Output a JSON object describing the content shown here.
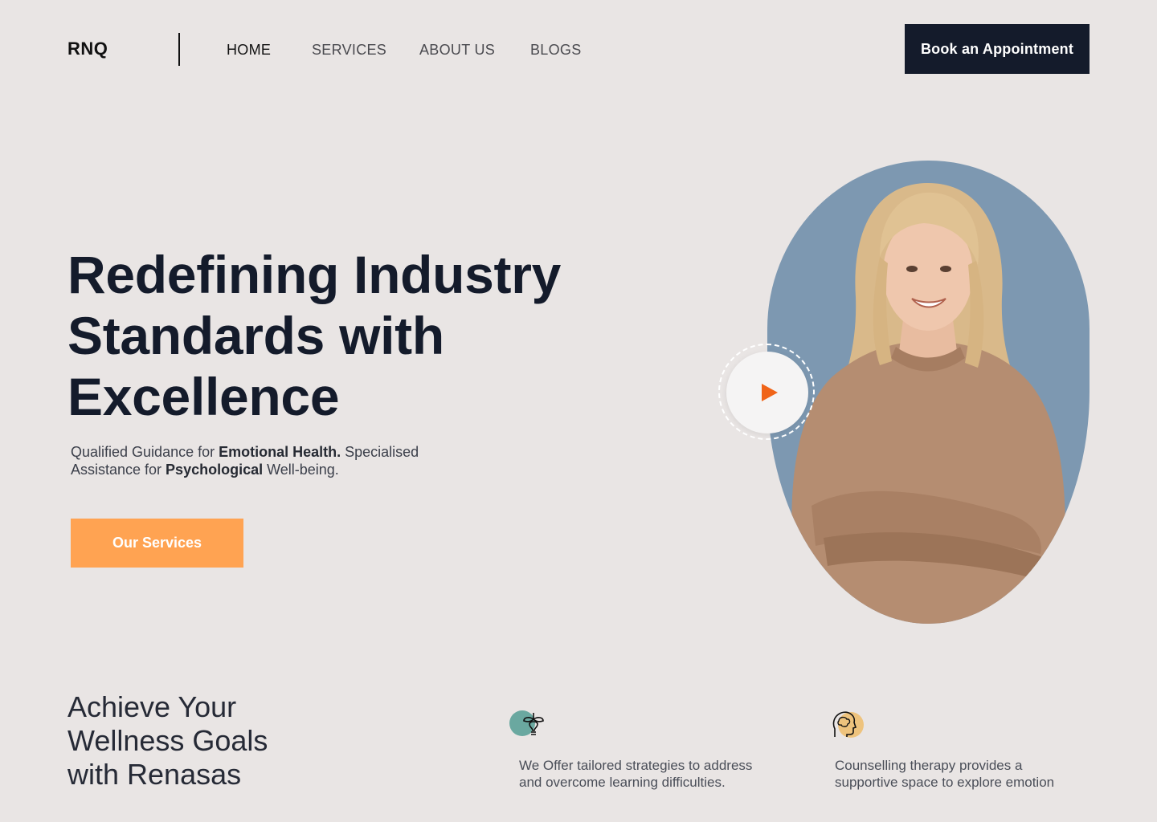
{
  "header": {
    "logo": "RNQ",
    "nav": [
      {
        "label": "HOME",
        "active": true
      },
      {
        "label": "SERVICES",
        "active": false
      },
      {
        "label": "ABOUT US",
        "active": false
      },
      {
        "label": "BLOGS",
        "active": false
      }
    ],
    "cta_label": "Book an Appointment"
  },
  "hero": {
    "title_lines": [
      "Redefining Industry",
      "Standards with",
      "Excellence"
    ],
    "sub_1": "Qualified Guidance for ",
    "sub_bold_1": "Emotional  Health.",
    "sub_2": " Specialised Assistance for ",
    "sub_bold_2": "Psychological",
    "sub_3": " Well-being.",
    "cta_label": "Our Services"
  },
  "wellness": {
    "title_lines": [
      "Achieve Your",
      "Wellness Goals",
      "with Renasas"
    ],
    "features": [
      {
        "icon": "lightbulb-growth-icon",
        "text_lines": [
          "We Offer tailored strategies to address",
          "and overcome learning difficulties."
        ]
      },
      {
        "icon": "head-brain-icon",
        "text_lines": [
          "Counselling therapy provides a",
          "supportive space to explore emotion"
        ]
      }
    ]
  },
  "colors": {
    "background": "#e9e5e4",
    "navy": "#141b2b",
    "orange": "#ffa352",
    "play_orange": "#f06418",
    "portrait_bg": "#7d98b1",
    "teal": "#6aa8a0",
    "gold": "#eec37d"
  }
}
